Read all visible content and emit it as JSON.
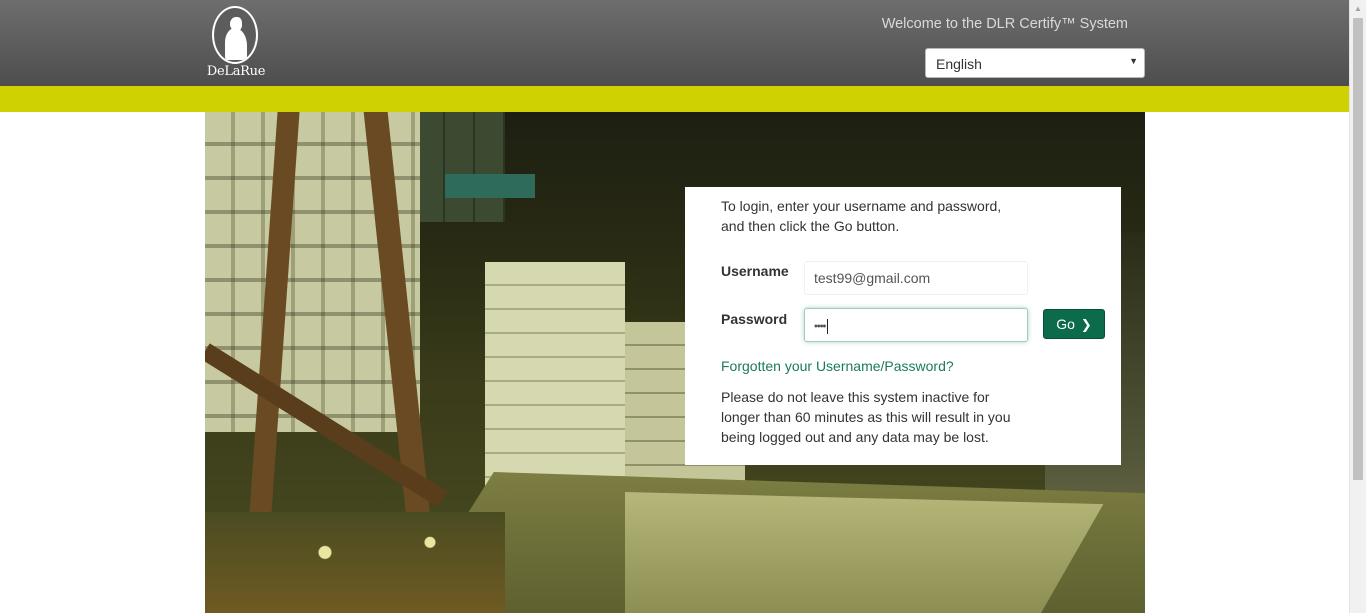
{
  "brand": {
    "name": "DeLaRue",
    "logo_icon": "delarue-seal-icon"
  },
  "header": {
    "welcome_text": "Welcome to the DLR Certify™ System",
    "language_selected": "English"
  },
  "colors": {
    "accent_bar": "#cfd100",
    "header_bg": "#5a5a5a",
    "go_button": "#0b6b4a",
    "link": "#1c7a5c"
  },
  "login": {
    "intro_line1": "To login, enter your username and password,",
    "intro_line2": "and then click the Go button.",
    "username_label": "Username",
    "username_value": "test99@gmail.com",
    "password_label": "Password",
    "password_masked": "••••",
    "go_label": "Go",
    "forgot_link": "Forgotten your Username/Password?",
    "notice_line1": "Please do not leave this system inactive for",
    "notice_line2": "longer than 60 minutes as this will result in you",
    "notice_line3": "being logged out and any data may be lost."
  }
}
